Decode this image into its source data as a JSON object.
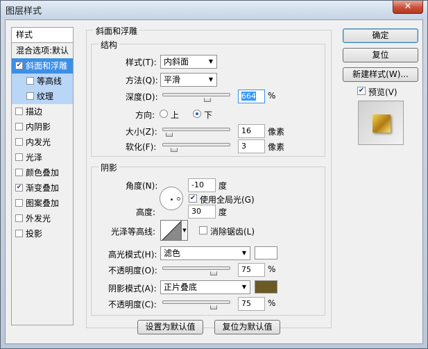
{
  "window": {
    "title": "图层样式",
    "close_label": "✕"
  },
  "sidebar": {
    "header": "样式",
    "items": [
      {
        "label": "混合选项:默认",
        "checkbox": false,
        "checked": false
      },
      {
        "label": "斜面和浮雕",
        "checkbox": true,
        "checked": true
      },
      {
        "label": "等高线",
        "checkbox": true,
        "checked": false
      },
      {
        "label": "纹理",
        "checkbox": true,
        "checked": false
      },
      {
        "label": "描边",
        "checkbox": true,
        "checked": false
      },
      {
        "label": "内阴影",
        "checkbox": true,
        "checked": false
      },
      {
        "label": "内发光",
        "checkbox": true,
        "checked": false
      },
      {
        "label": "光泽",
        "checkbox": true,
        "checked": false
      },
      {
        "label": "颜色叠加",
        "checkbox": true,
        "checked": false
      },
      {
        "label": "渐变叠加",
        "checkbox": true,
        "checked": true
      },
      {
        "label": "图案叠加",
        "checkbox": true,
        "checked": false
      },
      {
        "label": "外发光",
        "checkbox": true,
        "checked": false
      },
      {
        "label": "投影",
        "checkbox": true,
        "checked": false
      }
    ]
  },
  "bevel": {
    "title": "斜面和浮雕",
    "structure": {
      "title": "结构",
      "style_label": "样式(T):",
      "style_value": "内斜面",
      "technique_label": "方法(Q):",
      "technique_value": "平滑",
      "depth_label": "深度(D):",
      "depth_value": "664",
      "depth_unit": "%",
      "direction_label": "方向:",
      "direction_up": "上",
      "direction_down": "下",
      "direction_selected": "下",
      "size_label": "大小(Z):",
      "size_value": "16",
      "size_unit": "像素",
      "soften_label": "软化(F):",
      "soften_value": "3",
      "soften_unit": "像素"
    },
    "shading": {
      "title": "阴影",
      "angle_label": "角度(N):",
      "angle_value": "-10",
      "angle_unit": "度",
      "global_light_label": "使用全局光(G)",
      "global_light_checked": true,
      "altitude_label": "高度:",
      "altitude_value": "30",
      "altitude_unit": "度",
      "gloss_contour_label": "光泽等高线:",
      "anti_alias_label": "消除锯齿(L)",
      "anti_alias_checked": false,
      "highlight_mode_label": "高光模式(H):",
      "highlight_mode_value": "滤色",
      "highlight_color": "#ffffff",
      "highlight_opacity_label": "不透明度(O):",
      "highlight_opacity_value": "75",
      "highlight_opacity_unit": "%",
      "shadow_mode_label": "阴影模式(A):",
      "shadow_mode_value": "正片叠底",
      "shadow_color": "#6b5a25",
      "shadow_opacity_label": "不透明度(C):",
      "shadow_opacity_value": "75",
      "shadow_opacity_unit": "%"
    },
    "make_default_label": "设置为默认值",
    "reset_default_label": "复位为默认值"
  },
  "actions": {
    "ok_label": "确定",
    "reset_label": "复位",
    "new_style_label": "新建样式(W)...",
    "preview_label": "预览(V)",
    "preview_checked": true
  }
}
